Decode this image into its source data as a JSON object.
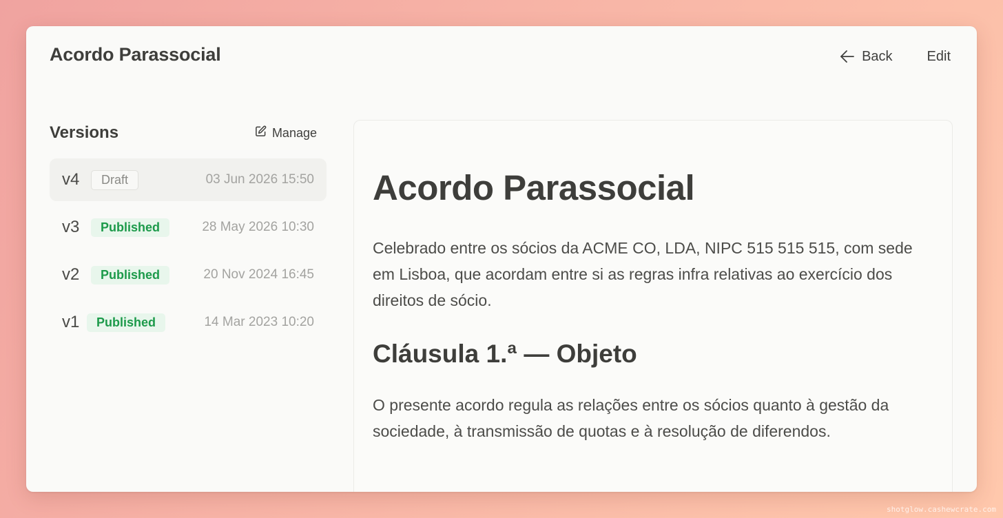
{
  "app": {
    "title": "Acordo Parassocial",
    "back_label": "Back",
    "edit_label": "Edit"
  },
  "sidebar": {
    "title": "Versions",
    "manage_label": "Manage",
    "versions": [
      {
        "label": "v4",
        "status": "Draft",
        "date": "03 Jun 2026 15:50",
        "selected": true
      },
      {
        "label": "v3",
        "status": "Published",
        "date": "28 May 2026 10:30",
        "selected": false
      },
      {
        "label": "v2",
        "status": "Published",
        "date": "20 Nov 2024 16:45",
        "selected": false
      },
      {
        "label": "v1",
        "status": "Published",
        "date": "14 Mar 2023 10:20",
        "selected": false
      }
    ]
  },
  "document": {
    "heading": "Acordo Parassocial",
    "intro": "Celebrado entre os sócios da ACME CO, LDA, NIPC 515 515 515, com sede em Lisboa, que acordam entre si as regras infra relativas ao exercício dos direitos de sócio.",
    "clause_heading": "Cláusula 1.ª — Objeto",
    "clause_text": "O presente acordo regula as relações entre os sócios quanto à gestão da sociedade, à transmissão de quotas e à resolução de diferendos."
  },
  "colors": {
    "published_text": "#1c9a4a",
    "published_bg": "#e8f6ec",
    "selected_row_bg": "#f1f1ee"
  },
  "watermark": "shotglow.cashewcrate.com"
}
